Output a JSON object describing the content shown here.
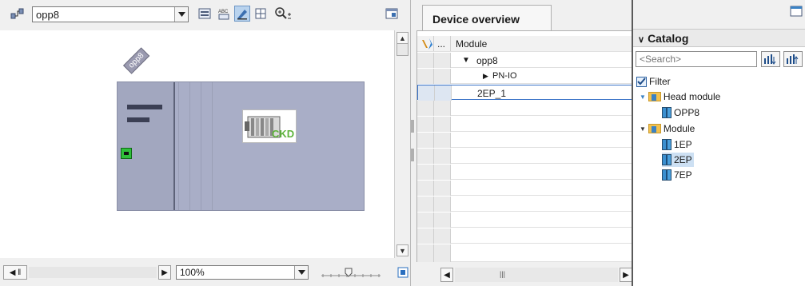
{
  "device_view": {
    "device_selector": {
      "value": "opp8"
    },
    "zoom_selector": {
      "value": "100%"
    },
    "rack": {
      "label": "opp8",
      "logo_text": "CKD"
    }
  },
  "device_overview": {
    "tab_label": "Device overview",
    "column_module": "Module",
    "column_dots": "...",
    "rows": [
      {
        "name": "opp8",
        "expander": "▼"
      },
      {
        "name": "PN-IO",
        "expander": "▶"
      },
      {
        "name": "2EP_1",
        "expander": ""
      }
    ]
  },
  "catalog": {
    "header": "Catalog",
    "search_placeholder": "<Search>",
    "filter_label": "Filter",
    "filter_checked": true,
    "groups": [
      {
        "label": "Head module",
        "items": [
          "OPP8"
        ]
      },
      {
        "label": "Module",
        "items": [
          "1EP",
          "2EP",
          "7EP"
        ]
      }
    ],
    "selected_item": "2EP"
  },
  "colors": {
    "rack_fill": "#a9aec7",
    "selection": "#cde0f3",
    "accent_blue": "#1f4e8a",
    "port_green": "#2fbf3a"
  }
}
